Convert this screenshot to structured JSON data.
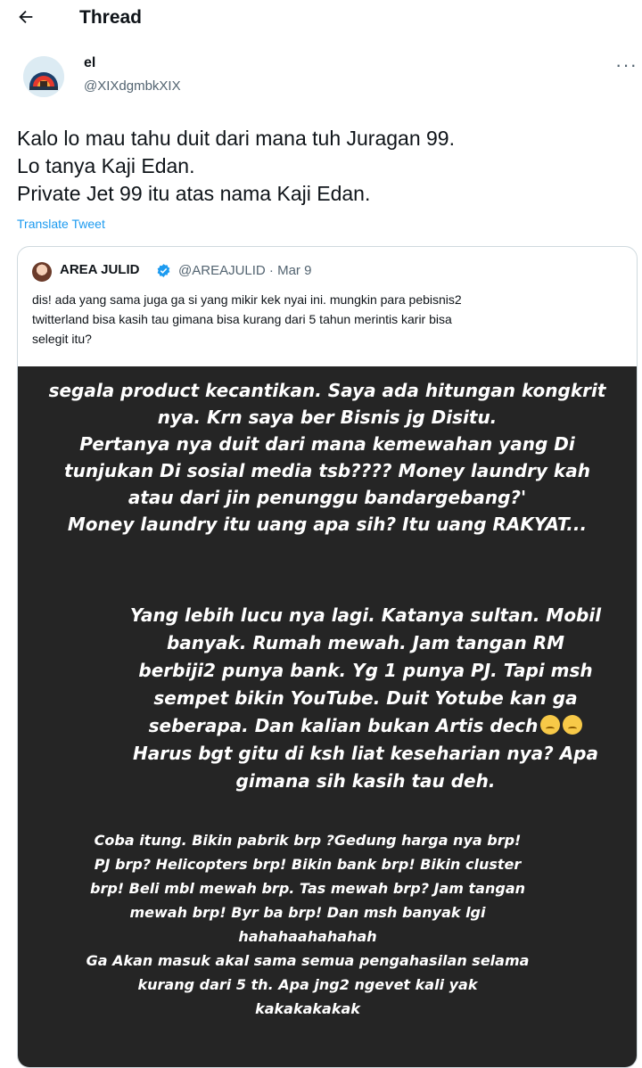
{
  "header": {
    "title": "Thread",
    "back_icon": "arrow-left-icon"
  },
  "tweet": {
    "author_name": "el",
    "author_handle": "@XIXdgmbkXIX",
    "more_icon": "more-horizontal-icon",
    "lines": [
      "Kalo lo mau tahu duit dari mana tuh Juragan 99.",
      "Lo tanya Kaji Edan.",
      "Private Jet 99 itu atas nama Kaji Edan."
    ],
    "translate_label": "Translate Tweet"
  },
  "quote": {
    "author_name": "AREA JULID",
    "verified_icon": "verified-badge-icon",
    "handle_date": "@AREAJULID · Mar 9",
    "lines": [
      "dis! ada yang sama juga ga si yang mikir kek nyai ini. mungkin para pebisnis2",
      "twitterland bisa kasih tau gimana bisa kurang dari 5 tahun merintis karir bisa",
      "selegit itu?"
    ],
    "media": {
      "block1": [
        "segala product kecantikan. Saya ada hitungan kongkrit",
        "nya. Krn saya ber Bisnis jg Disitu.",
        "Pertanya nya duit dari mana kemewahan yang Di",
        "tunjukan Di sosial media tsb???? Money laundry kah",
        "atau dari jin penunggu bandargebang?'",
        "Money laundry itu uang apa sih? Itu uang RAKYAT..."
      ],
      "block2": [
        "Yang lebih lucu nya lagi. Katanya sultan. Mobil",
        "banyak. Rumah mewah. Jam tangan RM",
        "berbiji2 punya bank. Yg 1 punya PJ. Tapi msh",
        "sempet bikin YouTube. Duit Yotube kan ga",
        "seberapa. Dan kalian bukan Artis dech",
        "Harus bgt gitu di ksh liat keseharian nya? Apa",
        "gimana sih kasih tau deh."
      ],
      "block3": [
        "Coba itung. Bikin pabrik brp ?Gedung harga nya brp!",
        "PJ brp? Helicopters brp! Bikin bank brp! Bikin cluster",
        "brp! Beli mbl mewah brp. Tas mewah brp? Jam tangan",
        "mewah brp! Byr ba brp! Dan msh banyak lgi",
        "hahahaahahahah",
        "Ga Akan masuk akal sama semua pengahasilan selama",
        "kurang dari  5 th. Apa jng2 ngevet kali yak",
        "kakakakakak"
      ],
      "emoji_icon": "pensive-face-emoji"
    }
  }
}
